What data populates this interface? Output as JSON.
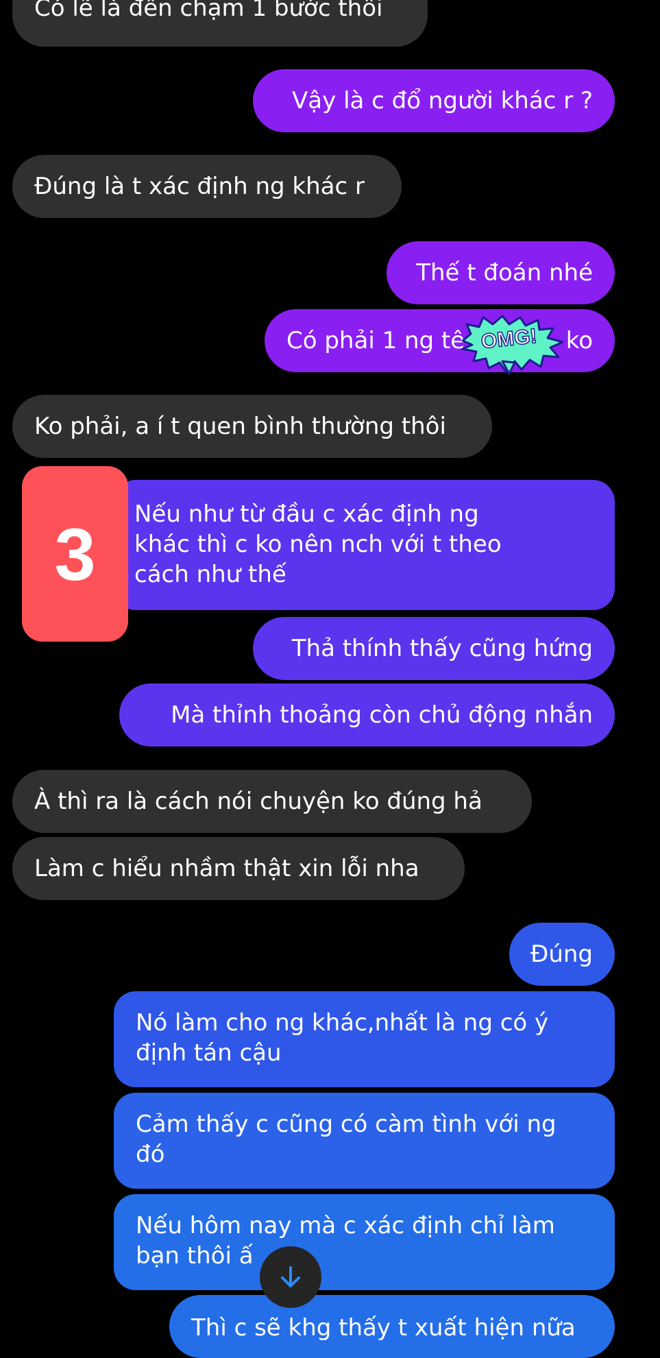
{
  "colors": {
    "background": "#000000",
    "incoming_bubble": "#303030",
    "outgoing_purple": "#8a1ff2",
    "outgoing_indigo": "#5b34ee",
    "outgoing_blue": "#2f58e8",
    "outgoing_azure": "#246ee8",
    "badge": "#ff5258",
    "stamp": "#5ff2c6"
  },
  "messages": [
    {
      "text": "Có lẽ là đến chạm 1 bước thôi"
    },
    {
      "text": "Vậy là c đổ người khác r ?"
    },
    {
      "text": "Đúng là t xác định ng khác r"
    },
    {
      "text": "Thế t đoán nhé"
    },
    {
      "text": "Có phải 1 ng tê",
      "tail": "ko"
    },
    {
      "text": "Ko phải, a í t quen bình thường thôi"
    },
    {
      "text": "Nếu như từ đầu c xác định ng khác thì c ko nên nch với t theo cách như thế"
    },
    {
      "text": "Thả thính thấy cũng hứng"
    },
    {
      "text": "Mà thỉnh thoảng còn chủ động nhắn"
    },
    {
      "text": "À thì ra là cách nói chuyện ko đúng hả"
    },
    {
      "text": "Làm c hiểu nhầm thật xin lỗi nha"
    },
    {
      "text": "Đúng"
    },
    {
      "text": "Nó làm cho ng khác,nhất là ng có ý định tán cậu"
    },
    {
      "text": "Cảm thấy c cũng có càm tình với ng đó"
    },
    {
      "text": "Nếu hôm nay mà c xác định chỉ làm bạn thôi ấ"
    },
    {
      "text": "Thì c sẽ khg thấy t xuất hiện nữa"
    }
  ],
  "sticker": {
    "text": "OMG!",
    "icon": "omg-burst-icon"
  },
  "badge": {
    "text": "3"
  },
  "scroll_button": {
    "icon": "arrow-down-icon"
  }
}
